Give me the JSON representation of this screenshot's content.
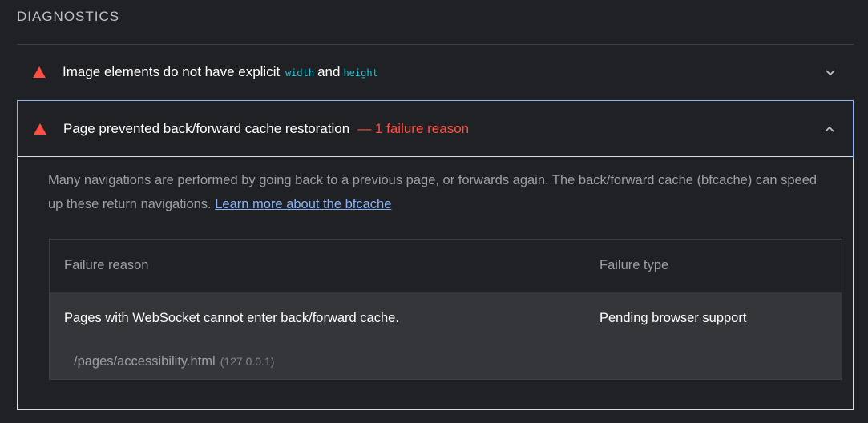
{
  "section": {
    "title": "DIAGNOSTICS"
  },
  "audits": [
    {
      "title_before": "Image elements do not have explicit",
      "code1": "width",
      "title_and": "and",
      "code2": "height",
      "expanded": false
    },
    {
      "title": "Page prevented back/forward cache restoration",
      "fail_count": "— 1 failure reason",
      "expanded": true,
      "description_text": "Many navigations are performed by going back to a previous page, or forwards again. The back/forward cache (bfcache) can speed up these return navigations.",
      "learn_more_label": "Learn more about the bfcache",
      "table": {
        "headers": [
          "Failure reason",
          "Failure type"
        ],
        "rows": [
          {
            "reason": "Pages with WebSocket cannot enter back/forward cache.",
            "type": "Pending browser support",
            "url": "/pages/accessibility.html",
            "host": "(127.0.0.1)"
          }
        ]
      }
    }
  ],
  "colors": {
    "background": "#202124",
    "fail": "#ff4e42",
    "link": "#8ab4f8",
    "code": "#21c7d8",
    "row_bg": "#35363a"
  },
  "icons": {
    "fail": "fail-triangle-icon",
    "expand": "chevron-down-icon",
    "collapse": "chevron-up-icon"
  }
}
